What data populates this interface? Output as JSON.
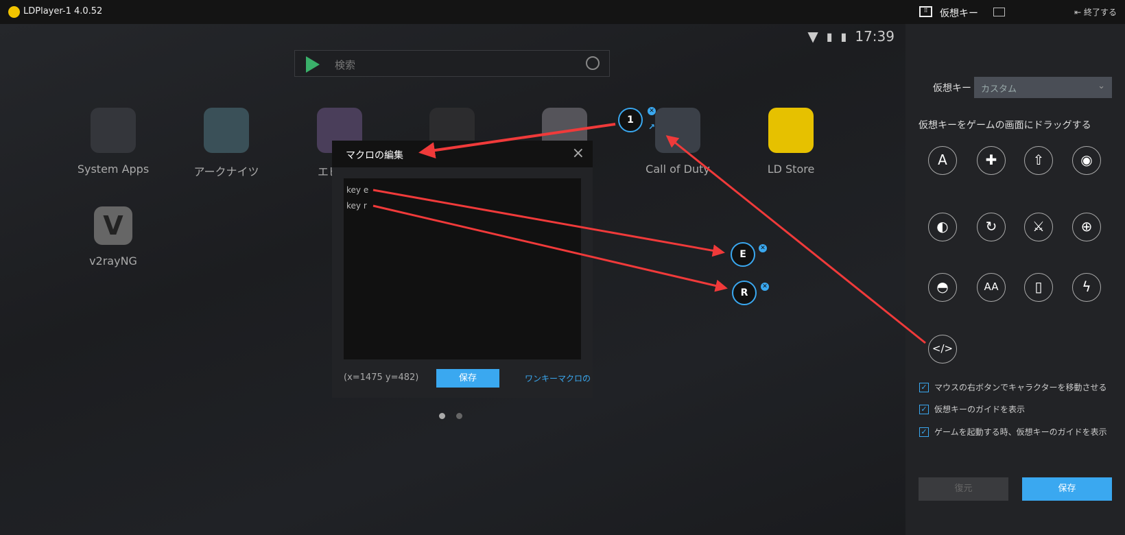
{
  "window": {
    "title": "LDPlayer-1 4.0.52",
    "logo": "LD"
  },
  "android": {
    "status": {
      "time": "17:39",
      "icons": [
        "wifi-icon",
        "no-sim-icon",
        "battery-charging-icon"
      ]
    },
    "search": {
      "placeholder": "検索"
    },
    "apps": [
      {
        "label": "System Apps"
      },
      {
        "label": "アークナイツ"
      },
      {
        "label": "エピック"
      },
      {
        "label": ""
      },
      {
        "label": ""
      },
      {
        "label": "Call of Duty"
      },
      {
        "label": "LD Store"
      },
      {
        "label": "v2rayNG"
      }
    ],
    "page_dots": 2,
    "active_dot": 0
  },
  "macro_dialog": {
    "title": "マクロの編集",
    "close": "×",
    "text": "key e\nkey r",
    "coords": "(x=1475  y=482)",
    "save": "保存",
    "link": "ワンキーマクロの"
  },
  "keys": [
    {
      "label": "1"
    },
    {
      "label": "E"
    },
    {
      "label": "R"
    }
  ],
  "panel": {
    "title": "仮想キー",
    "exit": "終了する",
    "select_label": "仮想キー",
    "select_value": "カスタム",
    "drag_hint": "仮想キーをゲームの画面にドラッグする",
    "key_icons": [
      {
        "name": "a-key-icon",
        "glyph": "A"
      },
      {
        "name": "dpad-icon",
        "glyph": "✚"
      },
      {
        "name": "bullet-icon",
        "glyph": "⇧"
      },
      {
        "name": "eye-icon",
        "glyph": "◉"
      },
      {
        "name": "mouse-rotate-icon",
        "glyph": "◐"
      },
      {
        "name": "rotate-view-icon",
        "glyph": "↻"
      },
      {
        "name": "crossed-swords-icon",
        "glyph": "⚔"
      },
      {
        "name": "crosshair-icon",
        "glyph": "⊕"
      },
      {
        "name": "mouse-icon",
        "glyph": "◓"
      },
      {
        "name": "aa-icon",
        "glyph": "AA"
      },
      {
        "name": "shake-phone-icon",
        "glyph": "▯"
      },
      {
        "name": "lightning-icon",
        "glyph": "ϟ"
      },
      {
        "name": "macro-script-icon",
        "glyph": "</>"
      }
    ],
    "checkboxes": [
      {
        "label": "マウスの右ボタンでキャラクターを移動させる",
        "checked": true
      },
      {
        "label": "仮想キーのガイドを表示",
        "checked": true
      },
      {
        "label": "ゲームを起動する時、仮想キーのガイドを表示",
        "checked": true
      }
    ],
    "restore": "復元",
    "save": "保存"
  },
  "colors": {
    "accent": "#3aa8f0",
    "annotation": "#f03a3a",
    "panel": "#222326"
  }
}
